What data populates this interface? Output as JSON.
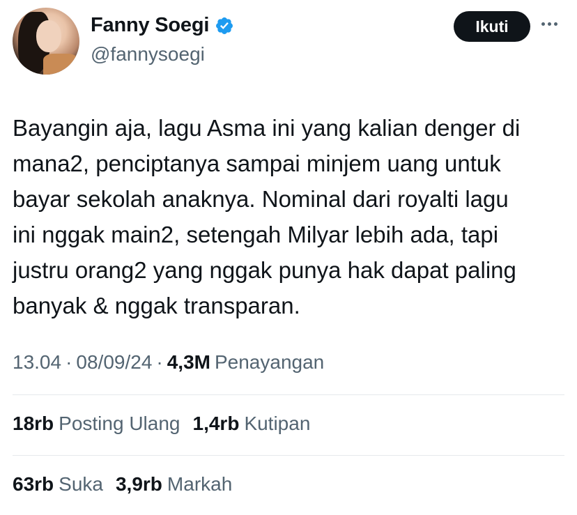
{
  "author": {
    "display_name": "Fanny Soegi",
    "handle": "@fannysoegi",
    "verified": true
  },
  "follow_label": "Ikuti",
  "tweet": {
    "text": "Bayangin aja, lagu Asma ini yang kalian denger di\nmana2, penciptanya sampai minjem uang untuk\nbayar sekolah anaknya. Nominal dari royalti lagu\nini nggak main2, setengah Milyar lebih ada, tapi\njustru orang2 yang nggak punya hak dapat paling\nbanyak & nggak transparan."
  },
  "meta": {
    "time": "13.04",
    "sep1": "·",
    "date": "08/09/24",
    "sep2": "·",
    "views_count": "4,3M",
    "views_label": "Penayangan"
  },
  "stats_row1": [
    {
      "num": "18rb",
      "label": "Posting Ulang"
    },
    {
      "num": "1,4rb",
      "label": "Kutipan"
    }
  ],
  "stats_row2": [
    {
      "num": "63rb",
      "label": "Suka"
    },
    {
      "num": "3,9rb",
      "label": "Markah"
    }
  ],
  "colors": {
    "text": "#0f1419",
    "secondary": "#536471",
    "verified": "#1d9bf0",
    "divider": "#e6e9ec"
  }
}
